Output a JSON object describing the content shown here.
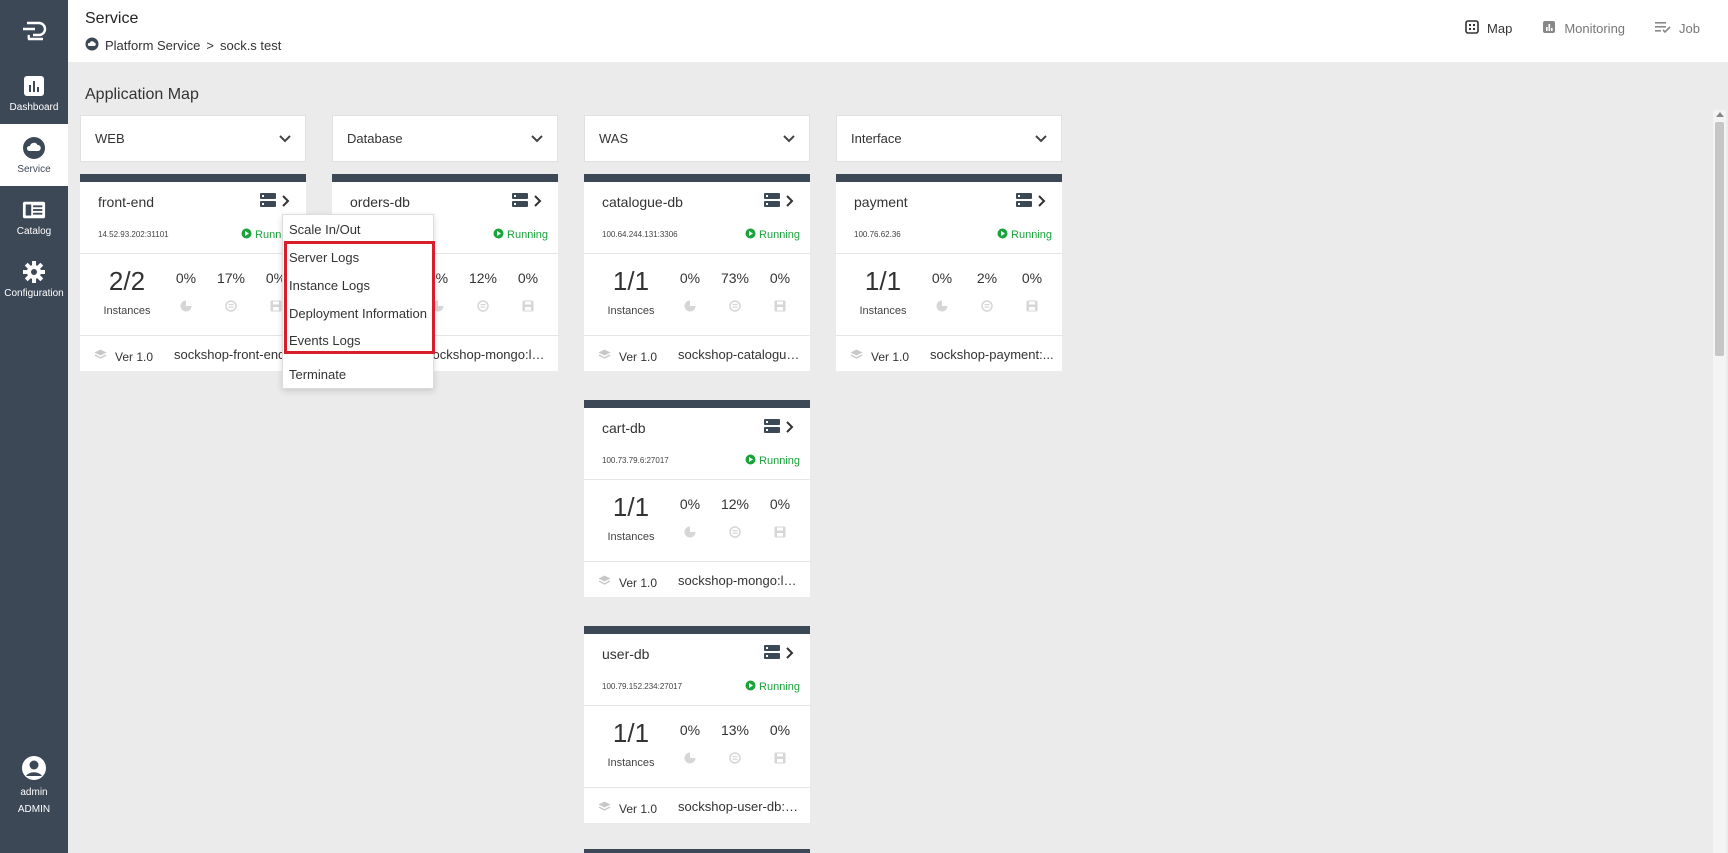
{
  "sidebar": {
    "items": [
      {
        "label": "Dashboard",
        "icon": "bar-chart-icon"
      },
      {
        "label": "Service",
        "icon": "cloud-icon"
      },
      {
        "label": "Catalog",
        "icon": "catalog-icon"
      },
      {
        "label": "Configuration",
        "icon": "gear-icon"
      }
    ],
    "user": {
      "name": "admin",
      "role": "ADMIN"
    }
  },
  "header": {
    "title": "Service",
    "breadcrumb": {
      "parent": "Platform Service",
      "separator": ">",
      "current": "sock.s test"
    },
    "actions": [
      {
        "label": "Map",
        "icon": "map-icon"
      },
      {
        "label": "Monitoring",
        "icon": "monitoring-icon"
      },
      {
        "label": "Job",
        "icon": "job-icon"
      }
    ]
  },
  "main": {
    "title": "Application Map",
    "columns": [
      {
        "label": "WEB"
      },
      {
        "label": "Database"
      },
      {
        "label": "WAS"
      },
      {
        "label": "Interface"
      }
    ],
    "cards": [
      {
        "name": "front-end",
        "ip": "14.52.93.202:31101",
        "status": "Running",
        "count": "2/2",
        "instances": "Instances",
        "cpu": "0%",
        "mem": "17%",
        "disk": "0%",
        "version": "Ver 1.0",
        "image": "sockshop-front-end"
      },
      {
        "name": "orders-db",
        "ip": "",
        "status": "Running",
        "count": "",
        "instances": "",
        "cpu": "0%",
        "mem": "12%",
        "disk": "0%",
        "version": "",
        "image": "sockshop-mongo:lat..."
      },
      {
        "name": "catalogue-db",
        "ip": "100.64.244.131:3306",
        "status": "Running",
        "count": "1/1",
        "instances": "Instances",
        "cpu": "0%",
        "mem": "73%",
        "disk": "0%",
        "version": "Ver 1.0",
        "image": "sockshop-catalogue..."
      },
      {
        "name": "payment",
        "ip": "100.76.62.36",
        "status": "Running",
        "count": "1/1",
        "instances": "Instances",
        "cpu": "0%",
        "mem": "2%",
        "disk": "0%",
        "version": "Ver 1.0",
        "image": "sockshop-payment:..."
      },
      {
        "name": "cart-db",
        "ip": "100.73.79.6:27017",
        "status": "Running",
        "count": "1/1",
        "instances": "Instances",
        "cpu": "0%",
        "mem": "12%",
        "disk": "0%",
        "version": "Ver 1.0",
        "image": "sockshop-mongo:lat..."
      },
      {
        "name": "user-db",
        "ip": "100.79.152.234:27017",
        "status": "Running",
        "count": "1/1",
        "instances": "Instances",
        "cpu": "0%",
        "mem": "13%",
        "disk": "0%",
        "version": "Ver 1.0",
        "image": "sockshop-user-db:0...."
      }
    ]
  },
  "context_menu": {
    "items": [
      "Scale In/Out",
      "Server Logs",
      "Instance Logs",
      "Deployment Information",
      "Events Logs",
      "Terminate"
    ]
  },
  "colors": {
    "sidebar": "#3d4857",
    "running": "#1aa33b",
    "highlight": "#d81e2b"
  }
}
